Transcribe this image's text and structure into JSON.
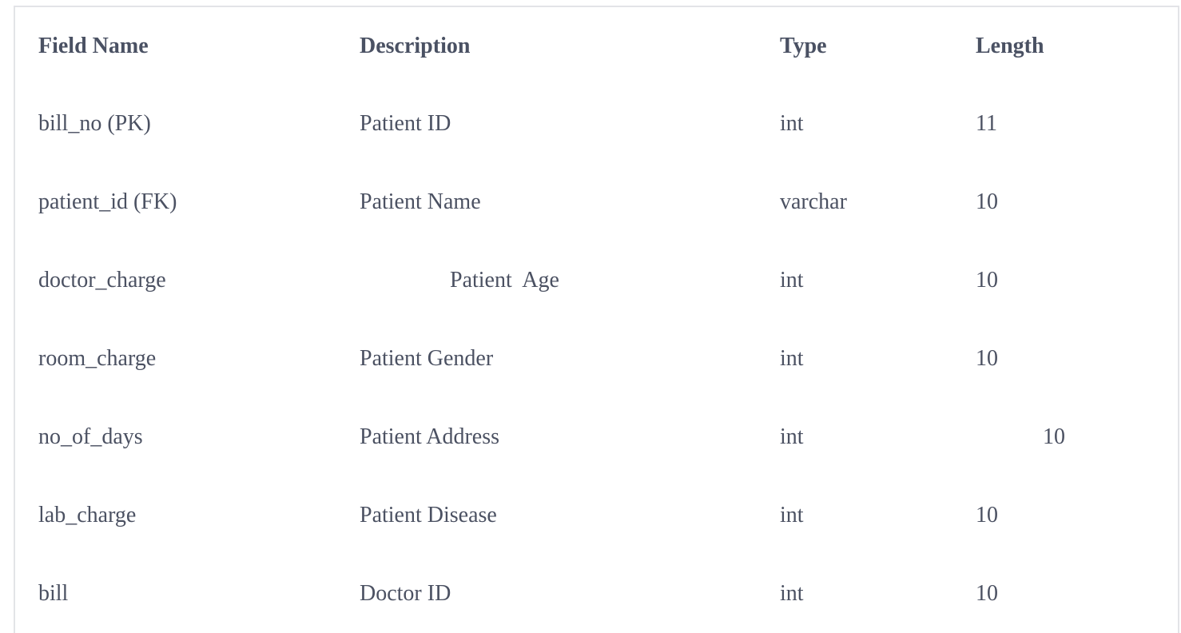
{
  "table": {
    "headers": {
      "field_name": "Field Name",
      "description": "Description",
      "type": "Type",
      "length": "Length"
    },
    "rows": [
      {
        "field_name": "bill_no (PK)",
        "description": "Patient ID",
        "type": "int",
        "length": "11"
      },
      {
        "field_name": "patient_id (FK)",
        "description": "Patient Name",
        "type": "varchar",
        "length": "10"
      },
      {
        "field_name": "doctor_charge",
        "description": "Patient  Age",
        "type": "int",
        "length": "10"
      },
      {
        "field_name": "room_charge",
        "description": "Patient Gender",
        "type": "int",
        "length": "10"
      },
      {
        "field_name": "no_of_days",
        "description": "Patient Address",
        "type": "int",
        "length": "10"
      },
      {
        "field_name": "lab_charge",
        "description": "Patient Disease",
        "type": "int",
        "length": "10"
      },
      {
        "field_name": "bill",
        "description": "Doctor ID",
        "type": "int",
        "length": "10"
      }
    ]
  }
}
